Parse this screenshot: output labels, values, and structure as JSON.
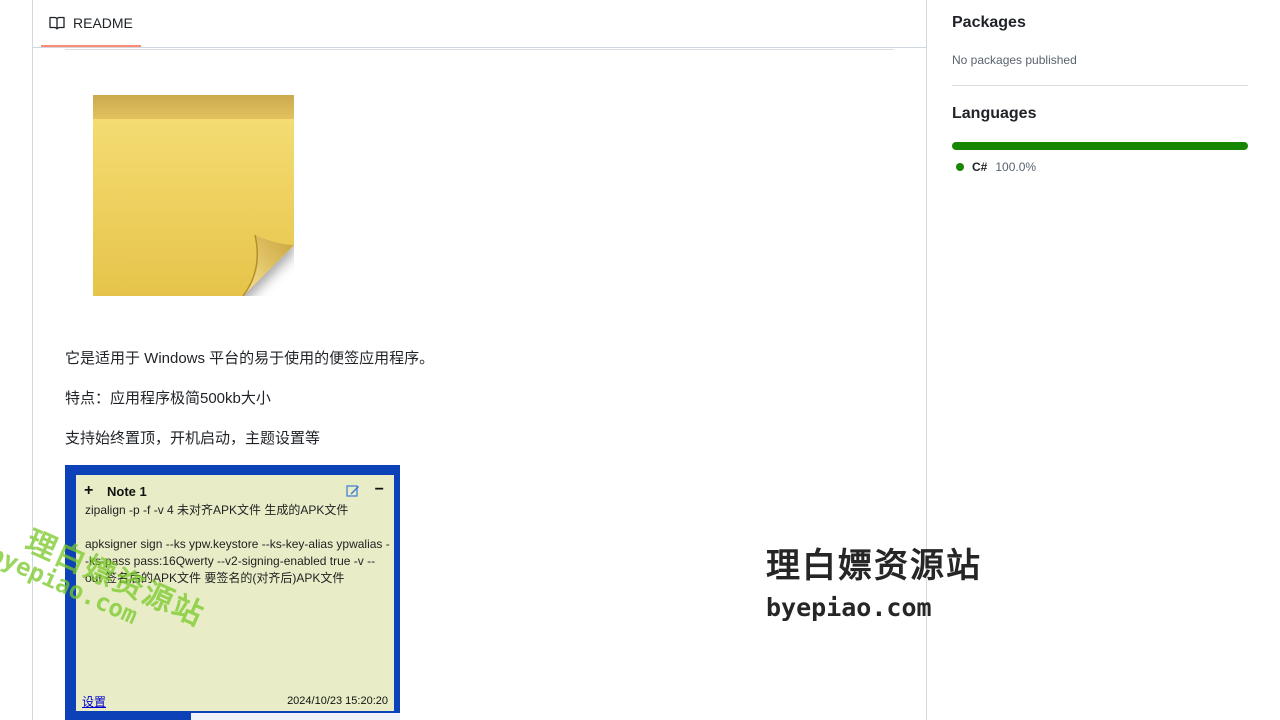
{
  "readme": {
    "tab_label": "README",
    "paragraphs": [
      "它是适用于 Windows 平台的易于使用的便签应用程序。",
      "特点：应用程序极简500kb大小",
      "支持始终置顶，开机启动，主题设置等"
    ]
  },
  "note_window": {
    "add": "+",
    "title": "Note 1",
    "minimize": "−",
    "body": "zipalign -p -f -v 4 未对齐APK文件 生成的APK文件\n\napksigner sign --ks ypw.keystore --ks-key-alias ypwalias --ks-pass pass:16Qwerty --v2-signing-enabled true -v --out 签名后的APK文件 要签名的(对齐后)APK文件",
    "settings_link": "设置",
    "timestamp": "2024/10/23 15:20:20"
  },
  "watermark": {
    "cn": "理白嫖资源站",
    "domain": "byepiao.com"
  },
  "sidebar": {
    "packages_title": "Packages",
    "packages_empty": "No packages published",
    "languages_title": "Languages",
    "languages": [
      {
        "name": "C#",
        "percent": "100.0%",
        "share": 100,
        "color": "#178600"
      }
    ]
  },
  "icons": {
    "readme_tab": "book-icon",
    "note_edit": "edit-icon",
    "sticky_note": "sticky-note-icon"
  }
}
